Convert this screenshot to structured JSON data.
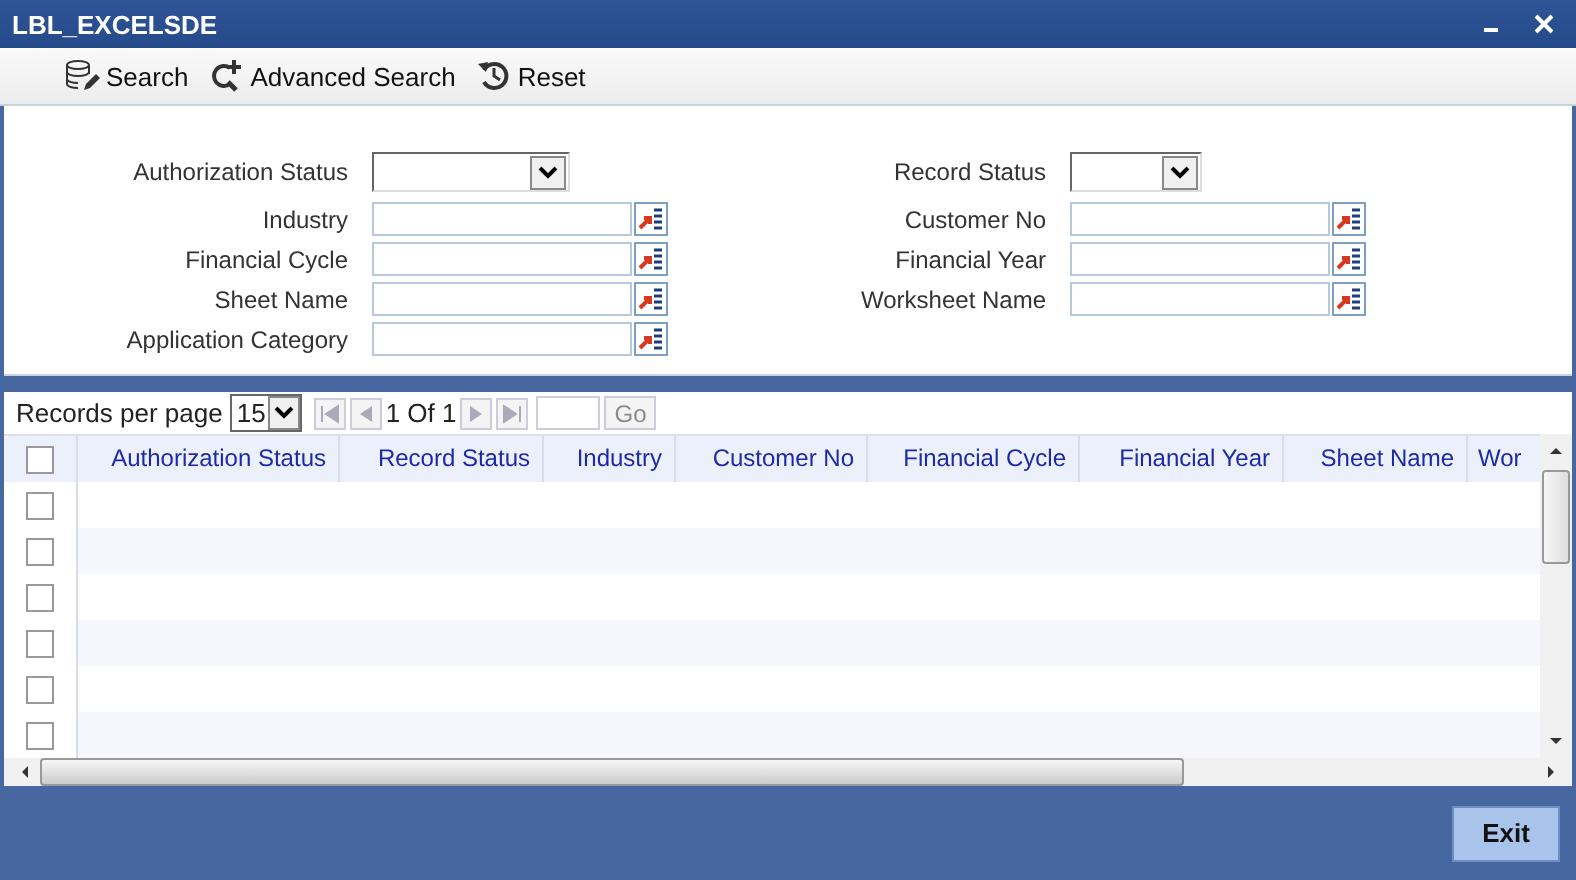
{
  "window": {
    "title": "LBL_EXCELSDE"
  },
  "toolbar": [
    {
      "label": "Search",
      "kind": "search"
    },
    {
      "label": "Advanced Search",
      "kind": "advanced"
    },
    {
      "label": "Reset",
      "kind": "reset"
    }
  ],
  "form": {
    "left": [
      {
        "label": "Authorization Status",
        "kind": "select"
      },
      {
        "label": "Industry",
        "kind": "lov"
      },
      {
        "label": "Financial Cycle",
        "kind": "lov"
      },
      {
        "label": "Sheet Name",
        "kind": "lov"
      },
      {
        "label": "Application Category",
        "kind": "lov"
      }
    ],
    "right": [
      {
        "label": "Record Status",
        "kind": "select"
      },
      {
        "label": "Customer No",
        "kind": "lov"
      },
      {
        "label": "Financial Year",
        "kind": "lov"
      },
      {
        "label": "Worksheet Name",
        "kind": "lov"
      }
    ]
  },
  "pager": {
    "label": "Records per page",
    "per_page": "15",
    "page_info": "1 Of 1",
    "go": "Go",
    "go_disabled": true
  },
  "table": {
    "columns": [
      "Authorization Status",
      "Record Status",
      "Industry",
      "Customer No",
      "Financial Cycle",
      "Financial Year",
      "Sheet Name",
      "Wor"
    ],
    "select_all": false,
    "rows": [
      {
        "checked": false
      },
      {
        "checked": false
      },
      {
        "checked": false
      },
      {
        "checked": false
      },
      {
        "checked": false
      },
      {
        "checked": false
      }
    ]
  },
  "buttons": [
    "Exit"
  ]
}
